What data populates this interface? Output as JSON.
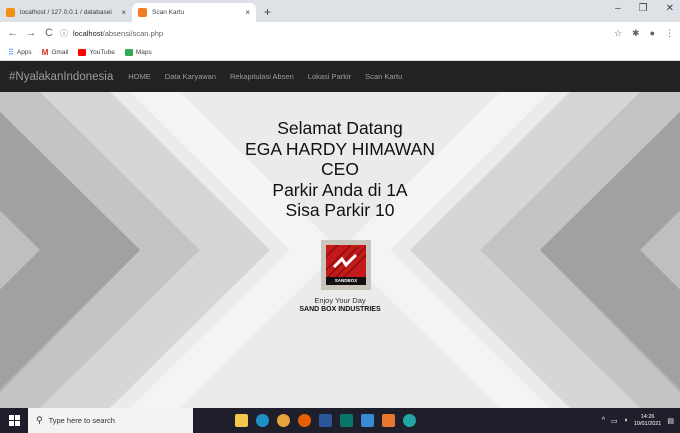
{
  "browser": {
    "tabs": [
      {
        "title": "localhost / 127.0.0.1 / databasei",
        "icon": "phpmyadmin-icon",
        "active": false
      },
      {
        "title": "Scan Kartu",
        "icon": "page-icon",
        "active": true
      }
    ],
    "close_glyph": "×",
    "newtab_glyph": "+",
    "window_controls": [
      "–",
      "❐",
      "✕"
    ],
    "url_host": "localhost",
    "url_path": "/absensi/scan.php",
    "bookmarks": [
      "Apps",
      "Gmail",
      "YouTube",
      "Maps"
    ]
  },
  "site": {
    "brand": "#NyalakanIndonesia",
    "nav": [
      "HOME",
      "Data Karyawan",
      "Rekapitulasi Absen",
      "Lokasi Parkir",
      "Scan Kartu"
    ]
  },
  "welcome": {
    "greeting": "Selamat Datang",
    "name": "EGA HARDY HIMAWAN",
    "position": "CEO",
    "parking_location": "Parkir Anda di 1A",
    "parking_remaining": "Sisa Parkir 10"
  },
  "logo": {
    "text": "SANDBOX"
  },
  "footer": {
    "tagline": "Enjoy Your Day",
    "company": "SAND BOX INDUSTRIES"
  },
  "taskbar": {
    "search_placeholder": "Type here to search",
    "time": "14:26",
    "date": "10/01/2021"
  },
  "colors": {
    "navbar_bg": "#222222",
    "navbar_text": "#9d9d9d",
    "taskbar_bg": "#1f1f2b"
  }
}
